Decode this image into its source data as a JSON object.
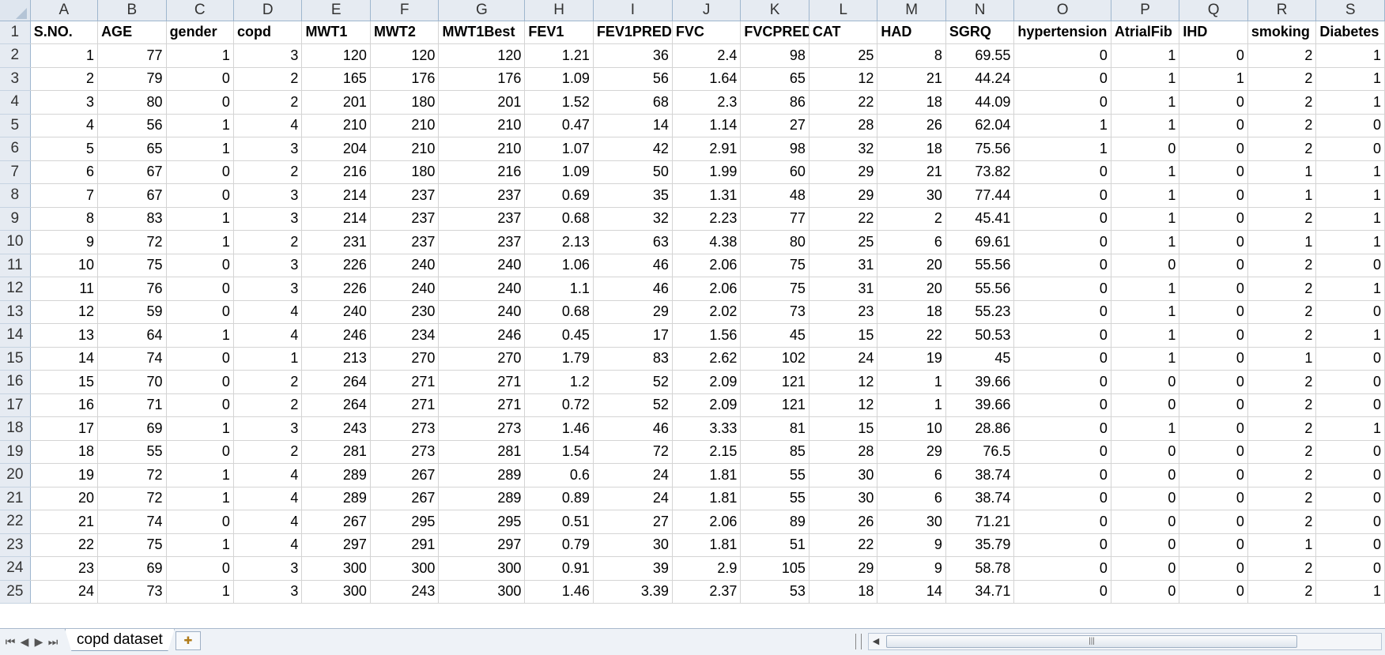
{
  "columns": [
    "A",
    "B",
    "C",
    "D",
    "E",
    "F",
    "G",
    "H",
    "I",
    "J",
    "K",
    "L",
    "M",
    "N",
    "O",
    "P",
    "Q",
    "R",
    "S"
  ],
  "header_row": [
    "S.NO.",
    "AGE",
    "gender",
    "copd",
    "MWT1",
    "MWT2",
    "MWT1Best",
    "FEV1",
    "FEV1PRED",
    "FVC",
    "FVCPRED",
    "CAT",
    "HAD",
    "SGRQ",
    "hypertension",
    "AtrialFib",
    "IHD",
    "smoking",
    "Diabetes"
  ],
  "rows": [
    [
      "1",
      "77",
      "1",
      "3",
      "120",
      "120",
      "120",
      "1.21",
      "36",
      "2.4",
      "98",
      "25",
      "8",
      "69.55",
      "0",
      "1",
      "0",
      "2",
      "1"
    ],
    [
      "2",
      "79",
      "0",
      "2",
      "165",
      "176",
      "176",
      "1.09",
      "56",
      "1.64",
      "65",
      "12",
      "21",
      "44.24",
      "0",
      "1",
      "1",
      "2",
      "1"
    ],
    [
      "3",
      "80",
      "0",
      "2",
      "201",
      "180",
      "201",
      "1.52",
      "68",
      "2.3",
      "86",
      "22",
      "18",
      "44.09",
      "0",
      "1",
      "0",
      "2",
      "1"
    ],
    [
      "4",
      "56",
      "1",
      "4",
      "210",
      "210",
      "210",
      "0.47",
      "14",
      "1.14",
      "27",
      "28",
      "26",
      "62.04",
      "1",
      "1",
      "0",
      "2",
      "0"
    ],
    [
      "5",
      "65",
      "1",
      "3",
      "204",
      "210",
      "210",
      "1.07",
      "42",
      "2.91",
      "98",
      "32",
      "18",
      "75.56",
      "1",
      "0",
      "0",
      "2",
      "0"
    ],
    [
      "6",
      "67",
      "0",
      "2",
      "216",
      "180",
      "216",
      "1.09",
      "50",
      "1.99",
      "60",
      "29",
      "21",
      "73.82",
      "0",
      "1",
      "0",
      "1",
      "1"
    ],
    [
      "7",
      "67",
      "0",
      "3",
      "214",
      "237",
      "237",
      "0.69",
      "35",
      "1.31",
      "48",
      "29",
      "30",
      "77.44",
      "0",
      "1",
      "0",
      "1",
      "1"
    ],
    [
      "8",
      "83",
      "1",
      "3",
      "214",
      "237",
      "237",
      "0.68",
      "32",
      "2.23",
      "77",
      "22",
      "2",
      "45.41",
      "0",
      "1",
      "0",
      "2",
      "1"
    ],
    [
      "9",
      "72",
      "1",
      "2",
      "231",
      "237",
      "237",
      "2.13",
      "63",
      "4.38",
      "80",
      "25",
      "6",
      "69.61",
      "0",
      "1",
      "0",
      "1",
      "1"
    ],
    [
      "10",
      "75",
      "0",
      "3",
      "226",
      "240",
      "240",
      "1.06",
      "46",
      "2.06",
      "75",
      "31",
      "20",
      "55.56",
      "0",
      "0",
      "0",
      "2",
      "0"
    ],
    [
      "11",
      "76",
      "0",
      "3",
      "226",
      "240",
      "240",
      "1.1",
      "46",
      "2.06",
      "75",
      "31",
      "20",
      "55.56",
      "0",
      "1",
      "0",
      "2",
      "1"
    ],
    [
      "12",
      "59",
      "0",
      "4",
      "240",
      "230",
      "240",
      "0.68",
      "29",
      "2.02",
      "73",
      "23",
      "18",
      "55.23",
      "0",
      "1",
      "0",
      "2",
      "0"
    ],
    [
      "13",
      "64",
      "1",
      "4",
      "246",
      "234",
      "246",
      "0.45",
      "17",
      "1.56",
      "45",
      "15",
      "22",
      "50.53",
      "0",
      "1",
      "0",
      "2",
      "1"
    ],
    [
      "14",
      "74",
      "0",
      "1",
      "213",
      "270",
      "270",
      "1.79",
      "83",
      "2.62",
      "102",
      "24",
      "19",
      "45",
      "0",
      "1",
      "0",
      "1",
      "0"
    ],
    [
      "15",
      "70",
      "0",
      "2",
      "264",
      "271",
      "271",
      "1.2",
      "52",
      "2.09",
      "121",
      "12",
      "1",
      "39.66",
      "0",
      "0",
      "0",
      "2",
      "0"
    ],
    [
      "16",
      "71",
      "0",
      "2",
      "264",
      "271",
      "271",
      "0.72",
      "52",
      "2.09",
      "121",
      "12",
      "1",
      "39.66",
      "0",
      "0",
      "0",
      "2",
      "0"
    ],
    [
      "17",
      "69",
      "1",
      "3",
      "243",
      "273",
      "273",
      "1.46",
      "46",
      "3.33",
      "81",
      "15",
      "10",
      "28.86",
      "0",
      "1",
      "0",
      "2",
      "1"
    ],
    [
      "18",
      "55",
      "0",
      "2",
      "281",
      "273",
      "281",
      "1.54",
      "72",
      "2.15",
      "85",
      "28",
      "29",
      "76.5",
      "0",
      "0",
      "0",
      "2",
      "0"
    ],
    [
      "19",
      "72",
      "1",
      "4",
      "289",
      "267",
      "289",
      "0.6",
      "24",
      "1.81",
      "55",
      "30",
      "6",
      "38.74",
      "0",
      "0",
      "0",
      "2",
      "0"
    ],
    [
      "20",
      "72",
      "1",
      "4",
      "289",
      "267",
      "289",
      "0.89",
      "24",
      "1.81",
      "55",
      "30",
      "6",
      "38.74",
      "0",
      "0",
      "0",
      "2",
      "0"
    ],
    [
      "21",
      "74",
      "0",
      "4",
      "267",
      "295",
      "295",
      "0.51",
      "27",
      "2.06",
      "89",
      "26",
      "30",
      "71.21",
      "0",
      "0",
      "0",
      "2",
      "0"
    ],
    [
      "22",
      "75",
      "1",
      "4",
      "297",
      "291",
      "297",
      "0.79",
      "30",
      "1.81",
      "51",
      "22",
      "9",
      "35.79",
      "0",
      "0",
      "0",
      "1",
      "0"
    ],
    [
      "23",
      "69",
      "0",
      "3",
      "300",
      "300",
      "300",
      "0.91",
      "39",
      "2.9",
      "105",
      "29",
      "9",
      "58.78",
      "0",
      "0",
      "0",
      "2",
      "0"
    ],
    [
      "24",
      "73",
      "1",
      "3",
      "300",
      "243",
      "300",
      "1.46",
      "3.39",
      "2.37",
      "53",
      "18",
      "14",
      "34.71",
      "0",
      "0",
      "0",
      "2",
      "1"
    ]
  ],
  "sheet_tab": "copd dataset",
  "nav_buttons": [
    "⏮",
    "◀",
    "▶",
    "⏭"
  ],
  "scroll_grip": "|||",
  "colors": {
    "header_bg": "#e6ebf2",
    "grid_line": "#d4d4d4",
    "header_border": "#9eb6ce"
  }
}
